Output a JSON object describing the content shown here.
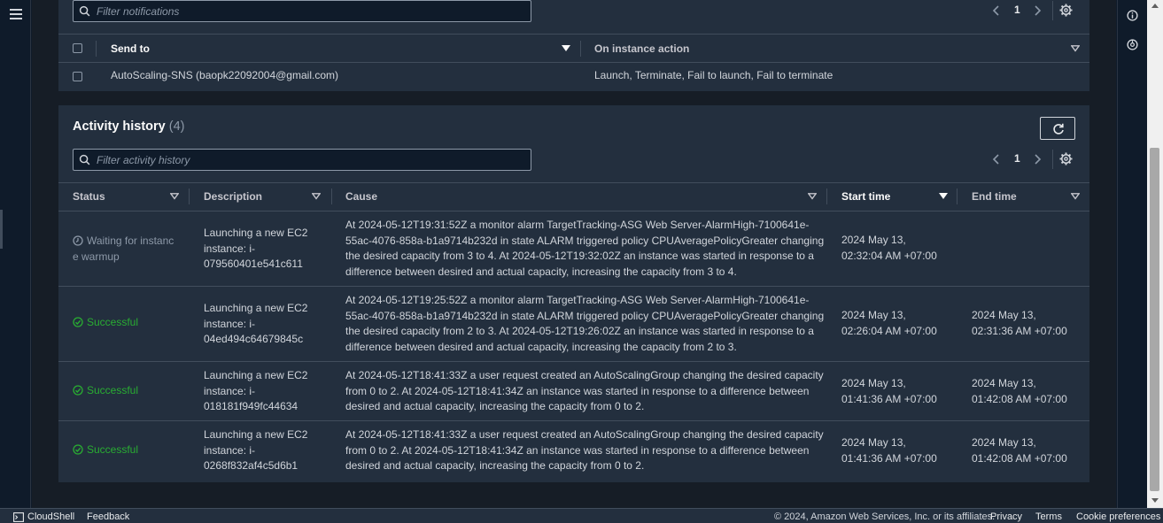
{
  "notifications": {
    "filter_placeholder": "Filter notifications",
    "page": "1",
    "columns": {
      "send_to": "Send to",
      "on_instance_action": "On instance action"
    },
    "rows": [
      {
        "send_to": "AutoScaling-SNS (baopk22092004@gmail.com)",
        "action": "Launch, Terminate, Fail to launch, Fail to terminate"
      }
    ]
  },
  "activity": {
    "title": "Activity history",
    "count": "(4)",
    "filter_placeholder": "Filter activity history",
    "page": "1",
    "columns": {
      "status": "Status",
      "description": "Description",
      "cause": "Cause",
      "start_time": "Start time",
      "end_time": "End time"
    },
    "rows": [
      {
        "status": "Waiting for instanc e warmup",
        "status_kind": "waiting",
        "desc_line1": "Launching a new EC2",
        "desc_line2": "instance: i-",
        "desc_line3": "079560401e541c611",
        "cause_line1": "At 2024-05-12T19:31:52Z a monitor alarm TargetTracking-ASG Web Server-AlarmHigh-7100641e-",
        "cause_line2": "55ac-4076-858a-b1a9714b232d in state ALARM triggered policy CPUAveragePolicyGreater changing",
        "cause_line3": "the desired capacity from 3 to 4. At 2024-05-12T19:32:02Z an instance was started in response to a",
        "cause_line4": "difference between desired and actual capacity, increasing the capacity from 3 to 4.",
        "start_line1": "2024 May 13,",
        "start_line2": "02:32:04 AM +07:00",
        "end_line1": "",
        "end_line2": ""
      },
      {
        "status": "Successful",
        "status_kind": "success",
        "desc_line1": "Launching a new EC2",
        "desc_line2": "instance: i-",
        "desc_line3": "04ed494c64679845c",
        "cause_line1": "At 2024-05-12T19:25:52Z a monitor alarm TargetTracking-ASG Web Server-AlarmHigh-7100641e-",
        "cause_line2": "55ac-4076-858a-b1a9714b232d in state ALARM triggered policy CPUAveragePolicyGreater changing",
        "cause_line3": "the desired capacity from 2 to 3. At 2024-05-12T19:26:02Z an instance was started in response to a",
        "cause_line4": "difference between desired and actual capacity, increasing the capacity from 2 to 3.",
        "start_line1": "2024 May 13,",
        "start_line2": "02:26:04 AM +07:00",
        "end_line1": "2024 May 13,",
        "end_line2": "02:31:36 AM +07:00"
      },
      {
        "status": "Successful",
        "status_kind": "success",
        "desc_line1": "Launching a new EC2",
        "desc_line2": "instance: i-",
        "desc_line3": "018181f949fc44634",
        "cause_line1": "At 2024-05-12T18:41:33Z a user request created an AutoScalingGroup changing the desired capacity",
        "cause_line2": "from 0 to 2. At 2024-05-12T18:41:34Z an instance was started in response to a difference between",
        "cause_line3": "desired and actual capacity, increasing the capacity from 0 to 2.",
        "cause_line4": "",
        "start_line1": "2024 May 13,",
        "start_line2": "01:41:36 AM +07:00",
        "end_line1": "2024 May 13,",
        "end_line2": "01:42:08 AM +07:00"
      },
      {
        "status": "Successful",
        "status_kind": "success",
        "desc_line1": "Launching a new EC2",
        "desc_line2": "instance: i-",
        "desc_line3": "0268f832af4c5d6b1",
        "cause_line1": "At 2024-05-12T18:41:33Z a user request created an AutoScalingGroup changing the desired capacity",
        "cause_line2": "from 0 to 2. At 2024-05-12T18:41:34Z an instance was started in response to a difference between",
        "cause_line3": "desired and actual capacity, increasing the capacity from 0 to 2.",
        "cause_line4": "",
        "start_line1": "2024 May 13,",
        "start_line2": "01:41:36 AM +07:00",
        "end_line1": "2024 May 13,",
        "end_line2": "01:42:08 AM +07:00"
      }
    ]
  },
  "footer": {
    "cloudshell": "CloudShell",
    "feedback": "Feedback",
    "copyright": "© 2024, Amazon Web Services, Inc. or its affiliates.",
    "privacy": "Privacy",
    "terms": "Terms",
    "cookie": "Cookie preferences"
  },
  "colors": {
    "success": "#29ad32",
    "panel": "#232f3e",
    "background": "#161d26",
    "accent_border": "#414d5c"
  },
  "icons": [
    "hamburger-icon",
    "info-icon",
    "notifications-icon",
    "search-icon",
    "chevron-left-icon",
    "chevron-right-icon",
    "gear-icon",
    "refresh-icon",
    "clock-icon",
    "check-circle-icon",
    "sort-caret-icon",
    "cloudshell-icon"
  ]
}
